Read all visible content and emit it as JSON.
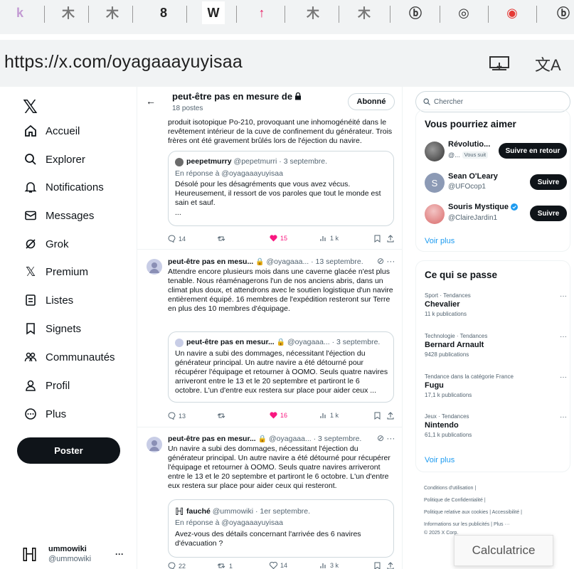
{
  "browser": {
    "tabs": [
      "k",
      "木",
      "木",
      "8",
      "W",
      "↑",
      "木",
      "木",
      "ⓑ",
      "◎",
      "◉",
      "ⓑ"
    ],
    "url": "https://x.com/oyagaaayuyisaa",
    "translate_icon": "文A"
  },
  "nav": {
    "items": [
      {
        "label": "Accueil",
        "icon": "home-icon"
      },
      {
        "label": "Explorer",
        "icon": "search-icon"
      },
      {
        "label": "Notifications",
        "icon": "bell-icon"
      },
      {
        "label": "Messages",
        "icon": "mail-icon"
      },
      {
        "label": "Grok",
        "icon": "grok-icon"
      },
      {
        "label": "Premium",
        "icon": "x-icon"
      },
      {
        "label": "Listes",
        "icon": "list-icon"
      },
      {
        "label": "Signets",
        "icon": "bookmark-icon"
      },
      {
        "label": "Communautés",
        "icon": "communities-icon"
      },
      {
        "label": "Profil",
        "icon": "profile-icon"
      },
      {
        "label": "Plus",
        "icon": "more-icon"
      }
    ],
    "post_button": "Poster",
    "user": {
      "name": "ummowiki",
      "handle": "@ummowiki",
      "more": "···"
    }
  },
  "header": {
    "back": "←",
    "title": "peut-être pas en mesure de",
    "posts_count": "18 postes",
    "follow_label": "Abonné"
  },
  "tweets": [
    {
      "text": "produit isotopique Po-210, provoquant une inhomogénéité dans le revêtement intérieur de la cuve de confinement du générateur. Trois frères ont été gravement brûlés lors de l'éjection du navire.",
      "quote": {
        "author": "peepetmurry",
        "meta": "@pepetmurri · 3 septembre.",
        "reply_to": "En réponse à @oyagaaayuyisaa",
        "text": "Désolé pour les désagréments que vous avez vécus. Heureusement, il ressort de vos paroles que tout le monde est sain et sauf.",
        "ellipsis": "..."
      },
      "stats": {
        "replies": "14",
        "retweets": "",
        "likes": "15",
        "views": "1 k"
      }
    },
    {
      "author": "peut-être pas en mesu...",
      "meta": "@oyagaaa... · 13 septembre.",
      "text": "Attendre encore plusieurs mois dans une caverne glacée n'est plus tenable. Nous réaménagerons l'un de nos anciens abris, dans un climat plus doux, et attendrons avec le soutien logistique d'un navire entièrement équipé. 16 membres de l'expédition resteront sur Terre en plus des 10 membres d'équipage.",
      "quote": {
        "author": "peut-être pas en mesur...",
        "meta": "@oyagaaa... · 3 septembre.",
        "text": "Un navire a subi des dommages, nécessitant l'éjection du générateur principal. Un autre navire a été détourné pour récupérer l'équipage et retourner à OOMO. Seuls quatre navires arriveront entre le 13 et le 20 septembre et partiront le 6 octobre. L'un d'entre eux restera sur place pour aider ceux ..."
      },
      "stats": {
        "replies": "13",
        "retweets": "",
        "likes": "16",
        "views": "1 k"
      }
    },
    {
      "author": "peut-être pas en mesur...",
      "meta": "@oyagaaa... · 3 septembre.",
      "text": "Un navire a subi des dommages, nécessitant l'éjection du générateur principal. Un autre navire a été détourné pour récupérer l'équipage et retourner à OOMO. Seuls quatre navires arriveront entre le 13 et le 20 septembre et partiront le 6 octobre. L'un d'entre eux restera sur place pour aider ceux qui resteront.",
      "quote": {
        "author": "fauché",
        "meta": "@ummowiki · 1er septembre.",
        "reply_to": "En réponse à @oyagaaayuyisaa",
        "text": "Avez-vous des détails concernant l'arrivée des 6 navires d'évacuation ?"
      },
      "stats": {
        "replies": "22",
        "retweets": "1",
        "likes": "14",
        "views": "3 k"
      }
    }
  ],
  "right": {
    "search_placeholder": "Chercher",
    "suggest_title": "Vous pourriez aimer",
    "suggestions": [
      {
        "name": "Révolutio...",
        "handle": "@...",
        "badge": "Vous suit",
        "button": "Suivre en retour"
      },
      {
        "name": "Sean O'Leary",
        "handle": "@UFOcop1",
        "button": "Suivre"
      },
      {
        "name": "Souris Mystique",
        "handle": "@ClaireJardin1",
        "button": "Suivre"
      }
    ],
    "see_more": "Voir plus",
    "trends_title": "Ce qui se passe",
    "trends": [
      {
        "context": "Sport · Tendances",
        "name": "Chevalier",
        "count": "11 k publications"
      },
      {
        "context": "Technologie · Tendances",
        "name": "Bernard Arnault",
        "count": "9428 publications"
      },
      {
        "context": "Tendance dans la catégorie France",
        "name": "Fugu",
        "count": "17,1 k publications"
      },
      {
        "context": "Jeux · Tendances",
        "name": "Nintendo",
        "count": "61,1 k publications"
      }
    ],
    "see_more2": "Voir plus",
    "footer": [
      "Conditions d'utilisation",
      "Politique de Confidentialité",
      "Politique relative aux cookies",
      "Accessibilité",
      "Informations sur les publicités",
      "Plus ···",
      "© 2025 X Corp."
    ],
    "tooltip": "Calculatrice"
  }
}
